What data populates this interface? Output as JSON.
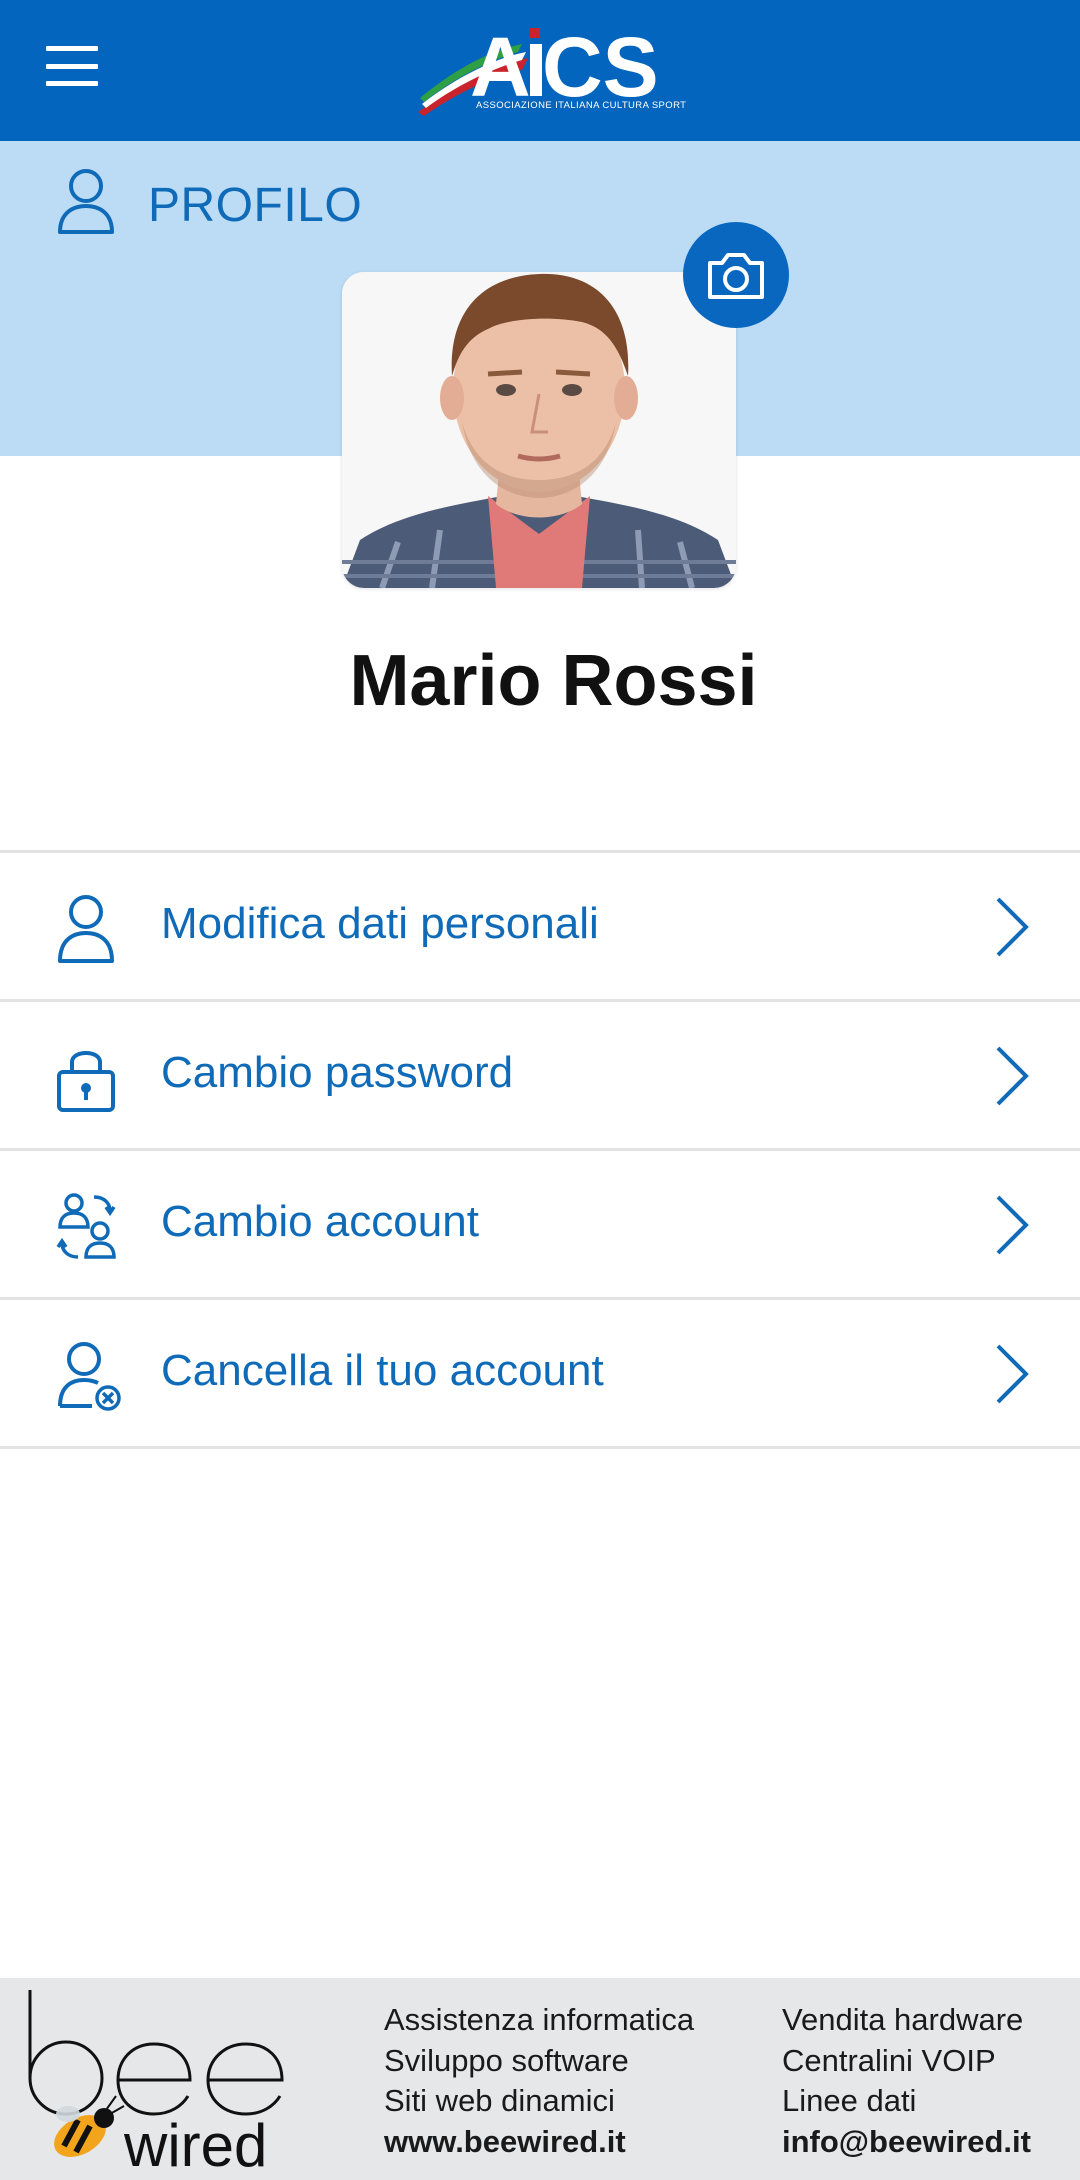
{
  "header": {
    "menu_icon": "hamburger-menu-icon",
    "logo_text": "AiCS",
    "logo_subtitle": "ASSOCIAZIONE ITALIANA CULTURA SPORT",
    "color": "#0365bd"
  },
  "profile": {
    "section_title": "PROFILO",
    "section_icon": "user-icon",
    "camera_icon": "camera-icon",
    "name": "Mario Rossi"
  },
  "menu": {
    "items": [
      {
        "label": "Modifica dati personali",
        "icon": "user-icon"
      },
      {
        "label": "Cambio password",
        "icon": "lock-icon"
      },
      {
        "label": "Cambio account",
        "icon": "switch-account-icon"
      },
      {
        "label": "Cancella il tuo account",
        "icon": "delete-user-icon"
      }
    ]
  },
  "footer": {
    "brand": "beewired",
    "col1": [
      "Assistenza informatica",
      "Sviluppo software",
      "Siti web dinamici",
      "www.beewired.it"
    ],
    "col2": [
      "Vendita hardware",
      "Centralini VOIP",
      "Linee dati",
      "info@beewired.it"
    ]
  },
  "colors": {
    "accent": "#0f6ab8",
    "band": "#bcdcf5",
    "footer": "#e6e7e9"
  }
}
